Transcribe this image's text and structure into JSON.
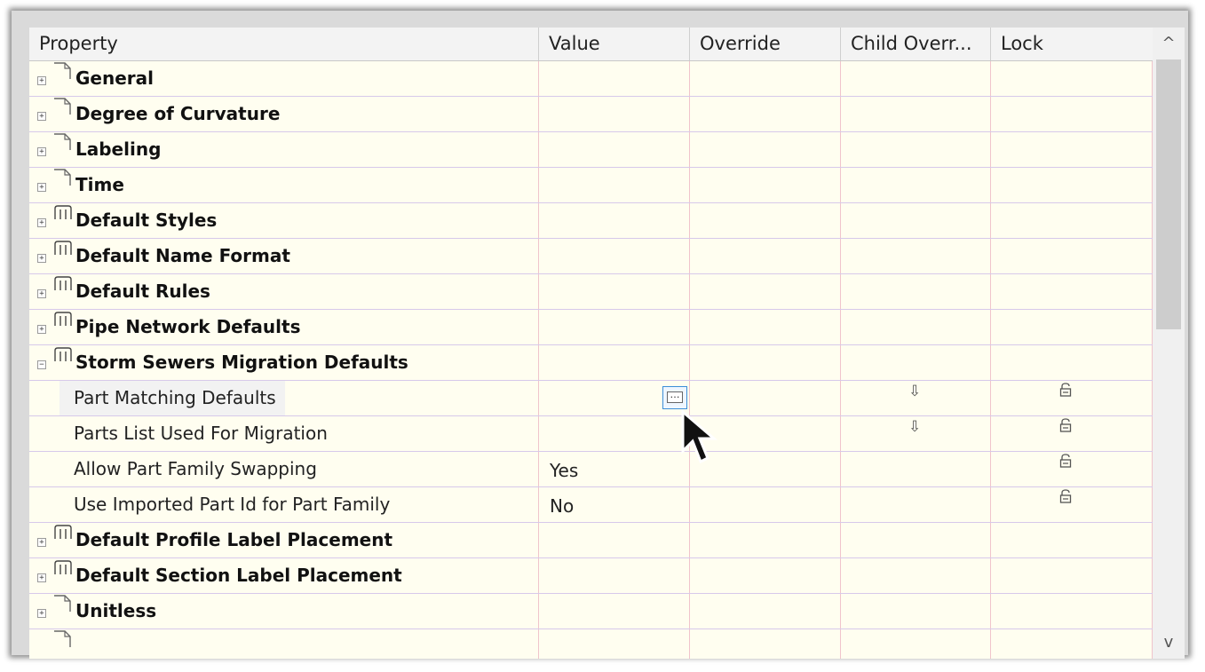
{
  "columns": [
    "Property",
    "Value",
    "Override",
    "Child Overr...",
    "Lock"
  ],
  "groups_top": [
    {
      "label": "General",
      "icon": "page-icon",
      "expander": "+"
    },
    {
      "label": "Degree of Curvature",
      "icon": "page-icon",
      "expander": "+"
    },
    {
      "label": "Labeling",
      "icon": "page-icon",
      "expander": "+"
    },
    {
      "label": "Time",
      "icon": "page-icon",
      "expander": "+"
    },
    {
      "label": "Default Styles",
      "icon": "style-icon",
      "expander": "+"
    },
    {
      "label": "Default Name Format",
      "icon": "style-icon",
      "expander": "+"
    },
    {
      "label": "Default Rules",
      "icon": "style-icon",
      "expander": "+"
    },
    {
      "label": "Pipe Network Defaults",
      "icon": "style-icon",
      "expander": "+"
    },
    {
      "label": "Storm Sewers Migration Defaults",
      "icon": "style-icon",
      "expander": "−"
    }
  ],
  "child_rows": [
    {
      "label": "Part Matching Defaults",
      "value": "",
      "child_override": "⇩",
      "lock": "🔒"
    },
    {
      "label": "Parts List Used For Migration",
      "value": "",
      "child_override": "⇩",
      "lock": "🔒"
    },
    {
      "label": "Allow Part Family Swapping",
      "value": "Yes",
      "child_override": "",
      "lock": "🔒"
    },
    {
      "label": "Use Imported Part Id for Part Family",
      "value": "No",
      "child_override": "",
      "lock": "🔒"
    }
  ],
  "groups_bottom": [
    {
      "label": "Default Profile Label Placement",
      "icon": "style-icon",
      "expander": "+"
    },
    {
      "label": "Default Section Label Placement",
      "icon": "style-icon",
      "expander": "+"
    },
    {
      "label": "Unitless",
      "icon": "page-icon",
      "expander": "+"
    }
  ],
  "ellipsis_button": "…",
  "scroll_up": "^",
  "scroll_down": "v",
  "colors": {
    "row_bg": "#fffef0",
    "row_border": "#d7c9ea",
    "col_border": "#f0c4cc",
    "selected_button_border": "#3c8ed8"
  }
}
